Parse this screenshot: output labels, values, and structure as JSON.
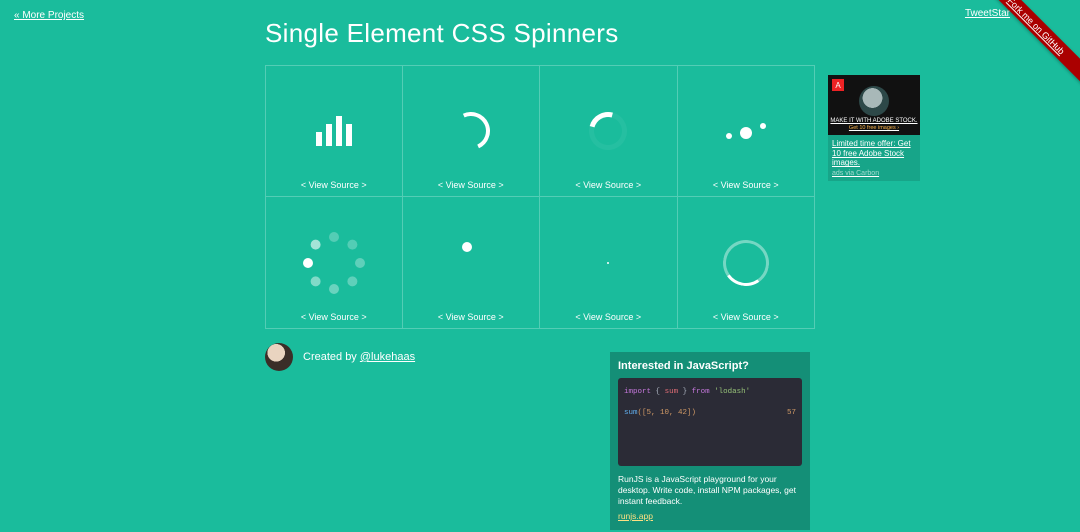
{
  "nav": {
    "more_projects": "« More Projects"
  },
  "share": {
    "tweet_star": "TweetStar",
    "fork": "Fork me on GitHub"
  },
  "title": "Single Element CSS Spinners",
  "view_source_label": "< View Source >",
  "credit": {
    "prefix": "Created by ",
    "handle": "@lukehaas"
  },
  "carbon": {
    "logo_glyph": "A",
    "headline": "MAKE IT WITH ADOBE STOCK.",
    "subhead": "Get 10 free images ›",
    "copy": "Limited time offer: Get 10 free Adobe Stock images.",
    "via": "ads via Carbon"
  },
  "promo": {
    "heading": "Interested in JavaScript?",
    "code": {
      "kw_import": "import",
      "brace_open": "{",
      "ident_sum": "sum",
      "brace_close": "}",
      "kw_from": "from",
      "str_lodash": "'lodash'",
      "call_sum": "sum",
      "args": "([5, 10, 42])",
      "result": "57"
    },
    "description": "RunJS is a JavaScript playground for your desktop. Write code, install NPM packages, get instant feedback.",
    "link_text": "runjs.app"
  }
}
